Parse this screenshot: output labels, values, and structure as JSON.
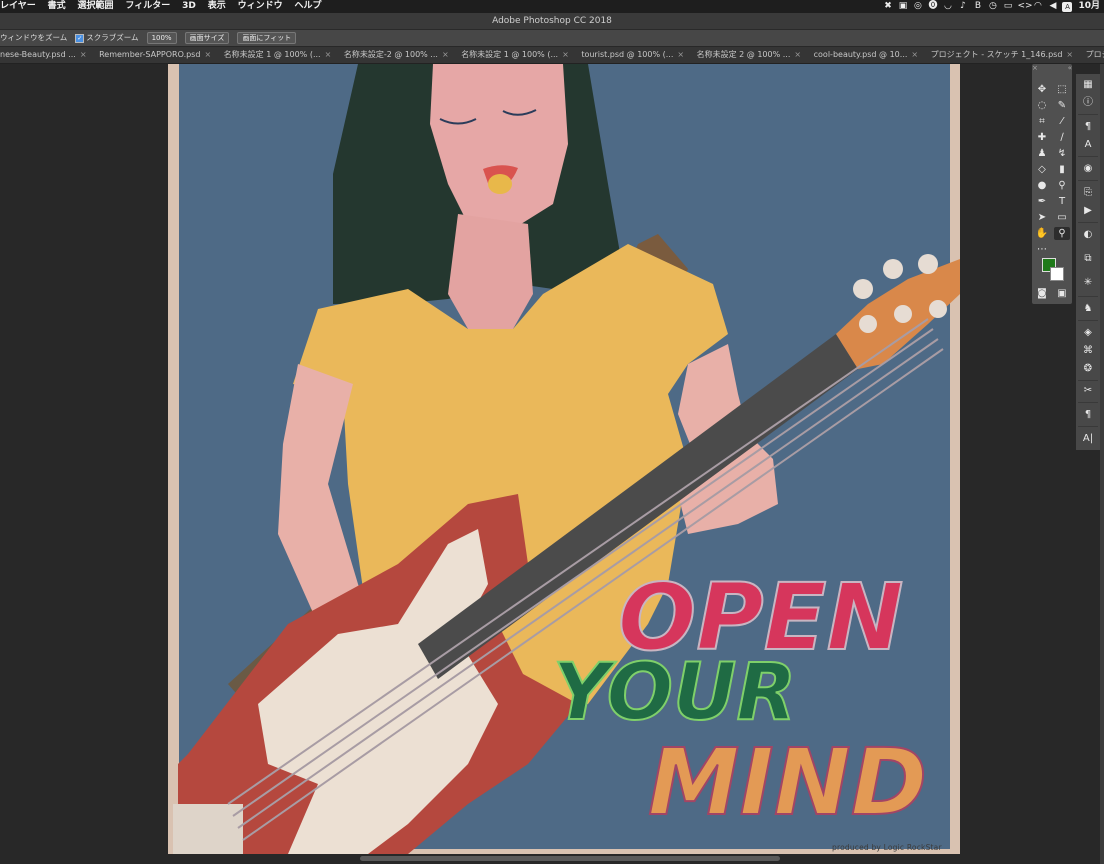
{
  "app": {
    "title": "Adobe Photoshop CC 2018"
  },
  "menubar": {
    "items": [
      "レイヤー",
      "書式",
      "選択範囲",
      "フィルター",
      "3D",
      "表示",
      "ウィンドウ",
      "ヘルプ"
    ],
    "clock": "10月",
    "user_initial": "A"
  },
  "options": {
    "check1": "ウィンドウをズーム",
    "check2": "スクラブズーム",
    "btn_zoom": "100%",
    "btn_screen": "画面サイズ",
    "btn_fit": "画面にフィット"
  },
  "tabs": [
    "nese-Beauty.psd ...",
    "Remember-SAPPORO.psd",
    "名称未設定 1 @ 100% (...",
    "名称未設定-2 @ 100% ...",
    "名称未設定 1 @ 100% (...",
    "tourist.psd @ 100% (...",
    "名称未設定 2 @ 100% ...",
    "cool-beauty.psd @ 10...",
    "プロジェクト - スケッチ 1_146.psd",
    "プロジェクト - スケッ"
  ],
  "artwork": {
    "line1": "OPEN",
    "line2": "YOUR",
    "line3": "MIND",
    "credit": "produced by  Logic RockStar"
  },
  "colors": {
    "foreground": "#1f7a1a",
    "background": "#ffffff"
  }
}
